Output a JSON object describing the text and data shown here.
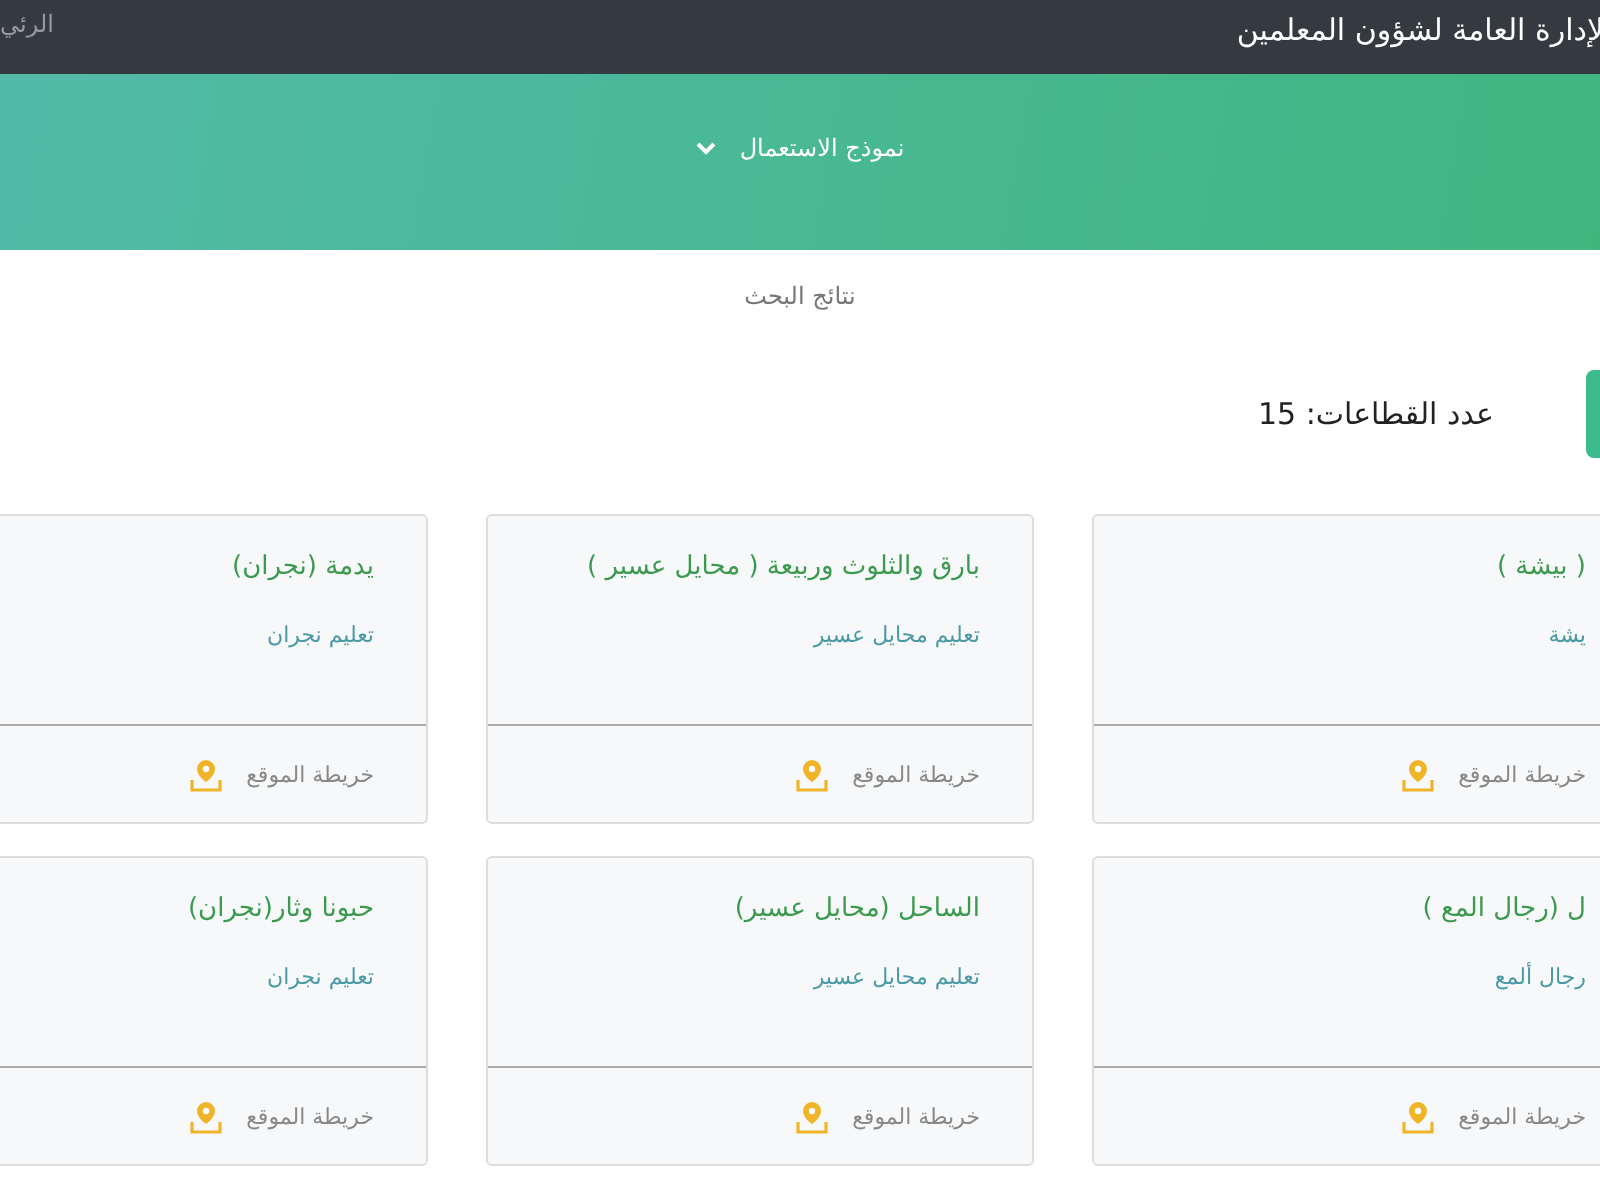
{
  "top_bar": {
    "title": "لإدارة العامة لشؤون المعلمين",
    "nav_link": "الرئي"
  },
  "banner": {
    "dropdown": "نموذج الاستعمال"
  },
  "section_title": "نتائج البحث",
  "count": {
    "label": "عدد القطاعات:",
    "value": "15"
  },
  "cards": [
    {
      "title": "( بيشة )",
      "subtitle": "يشة",
      "map_link": "خريطة الموقع"
    },
    {
      "title": "بارق والثلوث وربيعة ( محايل عسير )",
      "subtitle": "تعليم محايل عسير",
      "map_link": "خريطة الموقع"
    },
    {
      "title": "يدمة (نجران)",
      "subtitle": "تعليم نجران",
      "map_link": "خريطة الموقع"
    },
    {
      "title": "ل (رجال المع )",
      "subtitle": "رجال ألمع",
      "map_link": "خريطة الموقع"
    },
    {
      "title": "الساحل (محايل عسير)",
      "subtitle": "تعليم محايل عسير",
      "map_link": "خريطة الموقع"
    },
    {
      "title": "حبونا وثار(نجران)",
      "subtitle": "تعليم نجران",
      "map_link": "خريطة الموقع"
    }
  ]
}
